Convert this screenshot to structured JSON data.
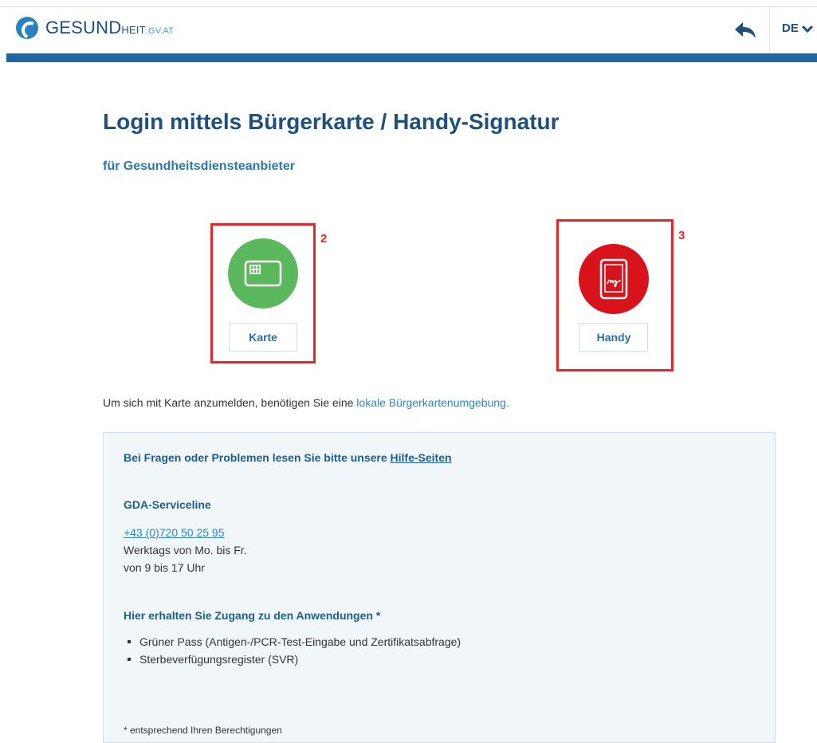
{
  "header": {
    "logo": {
      "brand": "GESUND",
      "suffix": "HEIT",
      "domain": ".GV.AT"
    },
    "back_icon": "back-arrow-icon",
    "language": "DE",
    "language_icon": "chevron-down-icon"
  },
  "main": {
    "title": "Login mittels Bürgerkarte / Handy-Signatur",
    "subtitle": "für Gesundheitsdiensteanbieter",
    "options": [
      {
        "label": "Karte",
        "icon": "card-icon",
        "color": "#5cb85c",
        "marker": "2"
      },
      {
        "label": "Handy",
        "icon": "mobile-signature-icon",
        "color": "#d9131b",
        "marker": "3"
      }
    ],
    "card_info_text": "Um sich mit Karte anzumelden, benötigen Sie eine",
    "card_info_link": "lokale Bürgerkartenumgebung."
  },
  "help_panel": {
    "heading_text": "Bei Fragen oder Problemen lesen Sie bitte unsere",
    "heading_link": "Hilfe-Seiten",
    "serviceline_title": "GDA-Serviceline",
    "phone": "+43 (0)720 50 25 95",
    "hours_line1": "Werktags von Mo. bis Fr.",
    "hours_line2": "von 9 bis 17 Uhr",
    "access_title": "Hier erhalten Sie Zugang zu den Anwendungen *",
    "applications": [
      "Grüner Pass (Antigen-/PCR-Test-Eingabe und Zertifikatsabfrage)",
      "Sterbeverfügungsregister (SVR)"
    ],
    "footnote": "* entsprechend Ihren Berechtigungen"
  },
  "colors": {
    "brand_blue": "#1f67a4",
    "title_blue": "#1e4f7d",
    "annotation_red": "#e4262b"
  }
}
